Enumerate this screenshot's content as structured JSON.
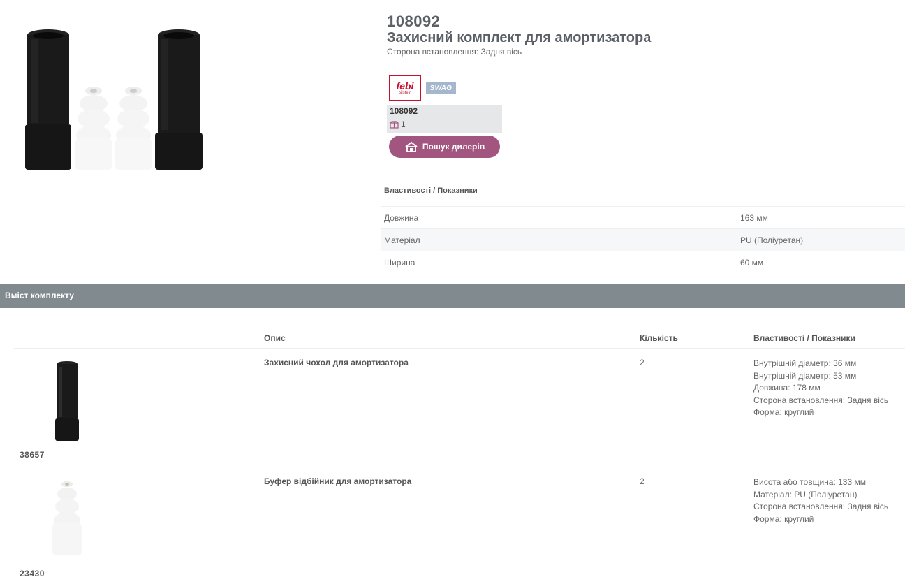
{
  "product": {
    "number": "108092",
    "title": "Захисний комплект для амортизатора",
    "subtitle": "Сторона встановлення: Задня вісь"
  },
  "brands": {
    "febi_text": "febi",
    "febi_small": "bilstein",
    "swag_text": "SWAG"
  },
  "qty_box": {
    "number": "108092",
    "qty": "1"
  },
  "dealer_button": {
    "label": "Пошук дилерів"
  },
  "properties": {
    "heading": "Властивості / Показники",
    "rows": [
      {
        "name": "Довжина",
        "value": "163 мм"
      },
      {
        "name": "Матеріал",
        "value": "PU (Поліуретан)"
      },
      {
        "name": "Ширина",
        "value": "60 мм"
      }
    ]
  },
  "kit": {
    "bar_title": "Вміст комплекту",
    "headers": {
      "desc": "Опис",
      "qty": "Кількість",
      "props": "Властивості / Показники"
    },
    "rows": [
      {
        "article": "38657",
        "desc": "Захисний чохол для амортизатора",
        "qty": "2",
        "attrs": [
          "Внутрішній діаметр: 36 мм",
          "Внутрішній діаметр: 53 мм",
          "Довжина: 178 мм",
          "Сторона встановлення: Задня вісь",
          "Форма: круглий"
        ]
      },
      {
        "article": "23430",
        "desc": "Буфер відбійник для амортизатора",
        "qty": "2",
        "attrs": [
          "Висота або товщина: 133 мм",
          "Матеріал: PU (Поліуретан)",
          "Сторона встановлення: Задня вісь",
          "Форма: круглий"
        ]
      }
    ]
  },
  "colors": {
    "accent_button": "#a2557f",
    "kit_bar": "#818a8e",
    "febi_red": "#c8102e",
    "swag_blue": "#a4b7cc"
  },
  "icons": {
    "qty_icon": "package-icon",
    "dealer_icon": "home-shop-icon"
  }
}
